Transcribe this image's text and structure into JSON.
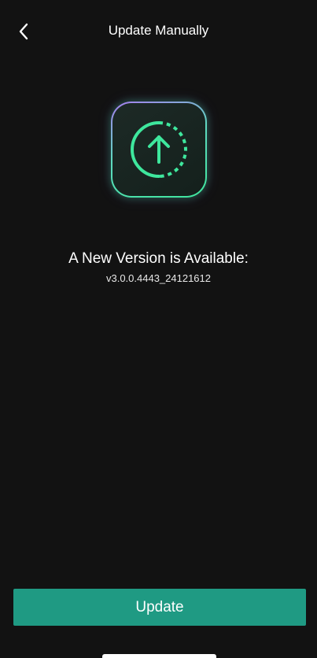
{
  "header": {
    "title": "Update Manually",
    "back_icon": "chevron-left-icon"
  },
  "app_icon": {
    "icon": "upload-arrow-circle-icon",
    "accent_color": "#3ee79d",
    "border_gradient": [
      "#a77cf0",
      "#3ee79d"
    ]
  },
  "content": {
    "headline": "A New Version is Available:",
    "version": "v3.0.0.4443_24121612"
  },
  "actions": {
    "update_label": "Update",
    "update_color": "#1f9a83"
  }
}
